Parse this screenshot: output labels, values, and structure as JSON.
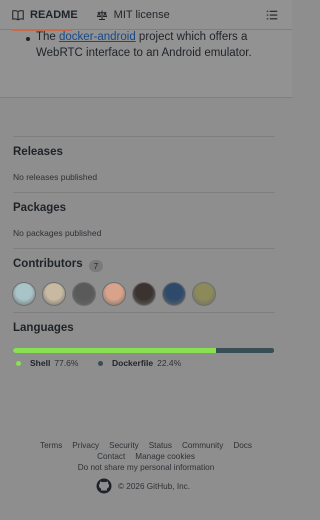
{
  "tabs": {
    "readme": "README",
    "license": "MIT license"
  },
  "readme": {
    "bullet_prefix": "The ",
    "bullet_link": "docker-android",
    "bullet_suffix": " project which offers a WebRTC interface to an Android emulator."
  },
  "releases": {
    "title": "Releases",
    "empty": "No releases published"
  },
  "packages": {
    "title": "Packages",
    "empty": "No packages published"
  },
  "contributors": {
    "title": "Contributors",
    "count": "7",
    "avatars": [
      {
        "icon": "avatar-1",
        "color": "#a9c4c8"
      },
      {
        "icon": "avatar-2",
        "color": "#c8b9a2"
      },
      {
        "icon": "avatar-3",
        "color": "#5a5a5a"
      },
      {
        "icon": "avatar-4",
        "color": "#d8a38a"
      },
      {
        "icon": "avatar-5",
        "color": "#3a3330"
      },
      {
        "icon": "avatar-6",
        "color": "#2e4a6a"
      },
      {
        "icon": "avatar-7",
        "color": "#8c8a5a"
      }
    ]
  },
  "languages": {
    "title": "Languages",
    "items": [
      {
        "name": "Shell",
        "percent": "77.6%",
        "value": 77.6,
        "color": "#89e051"
      },
      {
        "name": "Dockerfile",
        "percent": "22.4%",
        "value": 22.4,
        "color": "#384d54"
      }
    ]
  },
  "footer": {
    "links": [
      "Terms",
      "Privacy",
      "Security",
      "Status",
      "Community",
      "Docs"
    ],
    "links2": [
      "Contact",
      "Manage cookies"
    ],
    "privacy_notice": "Do not share my personal information",
    "copyright": "© 2026 GitHub, Inc."
  }
}
